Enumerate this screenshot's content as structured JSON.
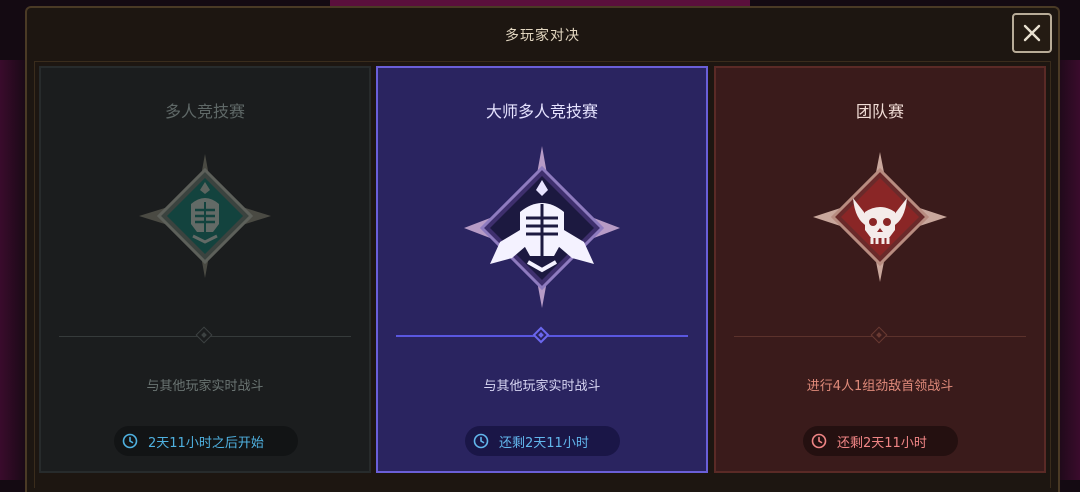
{
  "dialog": {
    "title": "多玩家对决",
    "close_icon": "close-icon"
  },
  "modes": [
    {
      "title": "多人竞技赛",
      "emblem_icon": "knight-helmet-emblem-icon",
      "description": "与其他玩家实时战斗",
      "timer": "2天11小时之后开始",
      "state": "locked",
      "accent": "#4fb1e0"
    },
    {
      "title": "大师多人竞技赛",
      "emblem_icon": "winged-helmet-emblem-icon",
      "description": "与其他玩家实时战斗",
      "timer": "还剩2天11小时",
      "state": "selected",
      "accent": "#6a5fd8"
    },
    {
      "title": "团队赛",
      "emblem_icon": "horned-skull-emblem-icon",
      "description": "进行4人1组劲敌首领战斗",
      "timer": "还剩2天11小时",
      "state": "active",
      "accent": "#f08585"
    }
  ]
}
